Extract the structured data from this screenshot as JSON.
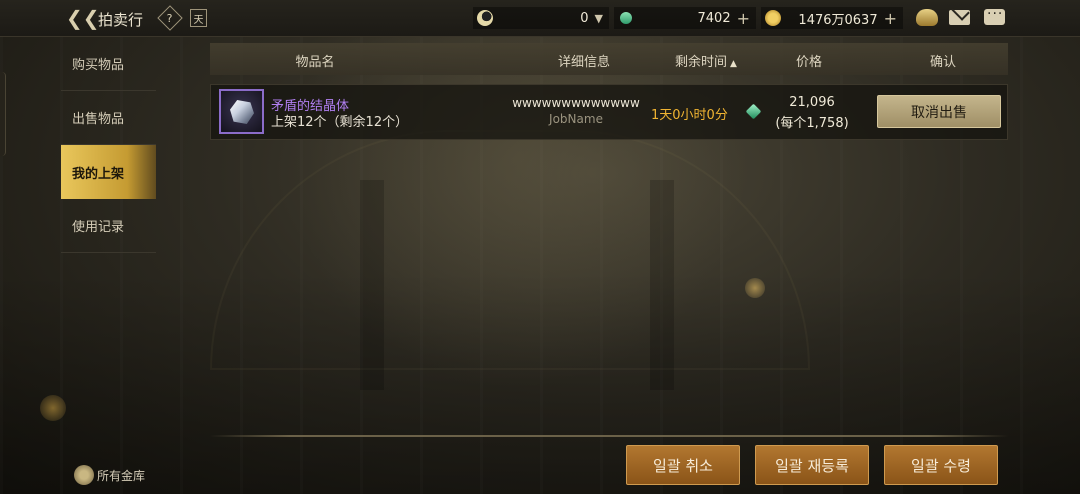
{
  "topbar": {
    "title": "拍卖行",
    "help_icon": "?",
    "calendar_icon": "天",
    "currencies": [
      {
        "icon": "moon-icon",
        "value": "0",
        "action": "dropdown"
      },
      {
        "icon": "gem-icon",
        "value": "7402",
        "action": "plus"
      },
      {
        "icon": "coin-icon",
        "value": "1476万0637",
        "action": "plus"
      }
    ],
    "right_icons": [
      "pot-icon",
      "mail-icon",
      "chat-icon"
    ]
  },
  "sidebar": {
    "items": [
      {
        "label": "购买物品",
        "active": false
      },
      {
        "label": "出售物品",
        "active": false
      },
      {
        "label": "我的上架",
        "active": true
      },
      {
        "label": "使用记录",
        "active": false
      }
    ]
  },
  "table": {
    "headers": {
      "item_name": "物品名",
      "details": "详细信息",
      "remaining_time": "剩余时间",
      "price": "价格",
      "confirm": "确认"
    },
    "sort_arrow": "▲",
    "rows": [
      {
        "name": "矛盾的结晶体",
        "quantity": "上架12个（剩余12个）",
        "seller": "wwwwwwwwwwwww",
        "job": "JobName",
        "remaining": "1天0小时0分",
        "price": "21,096",
        "unit_price": "(每个1,758)",
        "action": "取消出售"
      }
    ]
  },
  "bottom": {
    "vault_label": "所有金库",
    "buttons": [
      "일괄 취소",
      "일괄 재등록",
      "일괄 수령"
    ]
  },
  "colors": {
    "accent_gold": "#e9c75c",
    "item_name_purple": "#b07ff0",
    "time_orange": "#f0b432",
    "bottom_button": "#b27730"
  }
}
